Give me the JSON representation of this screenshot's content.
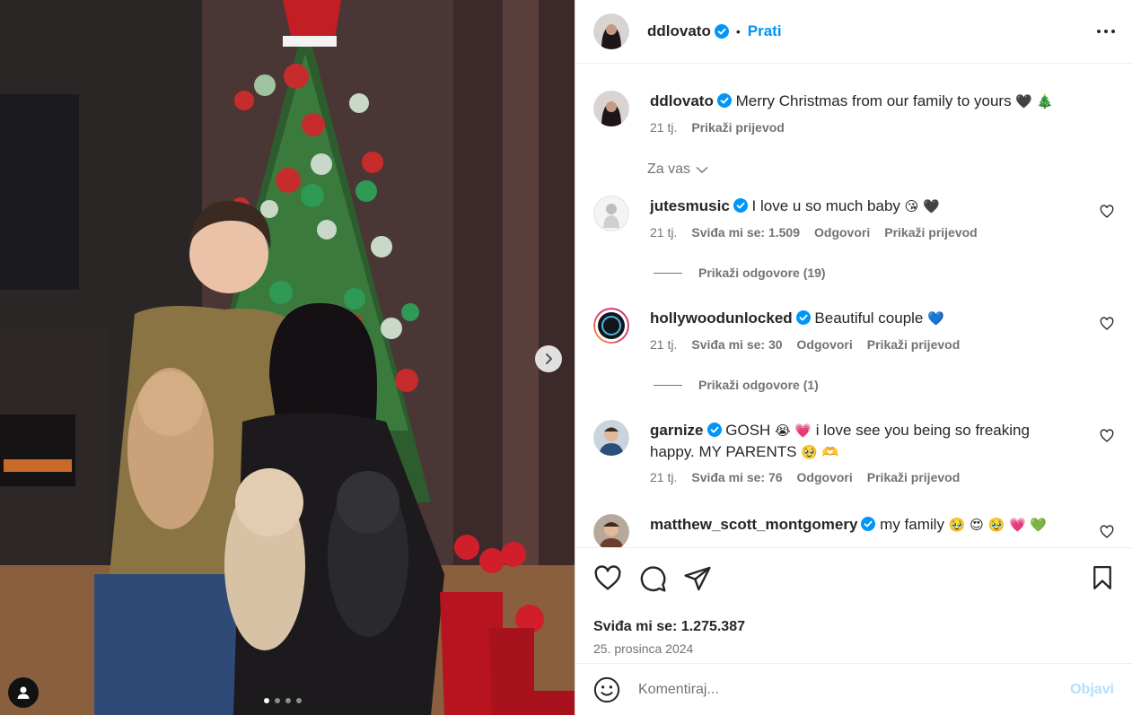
{
  "post": {
    "author": "ddlovato",
    "follow_label": "Prati",
    "caption": "Merry Christmas from our family to yours",
    "caption_emoji": "🖤 🎄",
    "caption_age": "21 tj.",
    "translate_label": "Prikaži prijevod",
    "likes_text": "Sviđa mi se: 1.275.387",
    "date_text": "25. prosinca 2024"
  },
  "carousel": {
    "slide_count": 4,
    "active_index": 0
  },
  "filter_label": "Za vas",
  "comments": [
    {
      "user": "jutesmusic",
      "text": "I love u so much baby",
      "emoji": "😘 🖤",
      "age": "21 tj.",
      "likes": "Sviđa mi se: 1.509",
      "reply": "Odgovori",
      "translate": "Prikaži prijevod",
      "replies_label": "Prikaži odgovore (19)"
    },
    {
      "user": "hollywoodunlocked",
      "text": "Beautiful couple",
      "emoji": "💙",
      "age": "21 tj.",
      "likes": "Sviđa mi se: 30",
      "reply": "Odgovori",
      "translate": "Prikaži prijevod",
      "replies_label": "Prikaži odgovore (1)"
    },
    {
      "user": "garnize",
      "text_a": "GOSH",
      "emoji_a": "😭 💗",
      "text_b": "i love see you being so freaking happy.",
      "text_c": "MY PARENTS",
      "emoji_c": "🥹 🫶",
      "age": "21 tj.",
      "likes": "Sviđa mi se: 76",
      "reply": "Odgovori",
      "translate": "Prikaži prijevod"
    },
    {
      "user": "matthew_scott_montgomery",
      "text": "my family",
      "emoji": "🥹 😍 🥹 💗 💚"
    }
  ],
  "composer": {
    "placeholder": "Komentiraj...",
    "post_label": "Objavi"
  },
  "colors": {
    "link_blue": "#0095f6",
    "verified_blue": "#0095f6",
    "muted": "#737373",
    "post_disabled": "#b2dffc"
  }
}
